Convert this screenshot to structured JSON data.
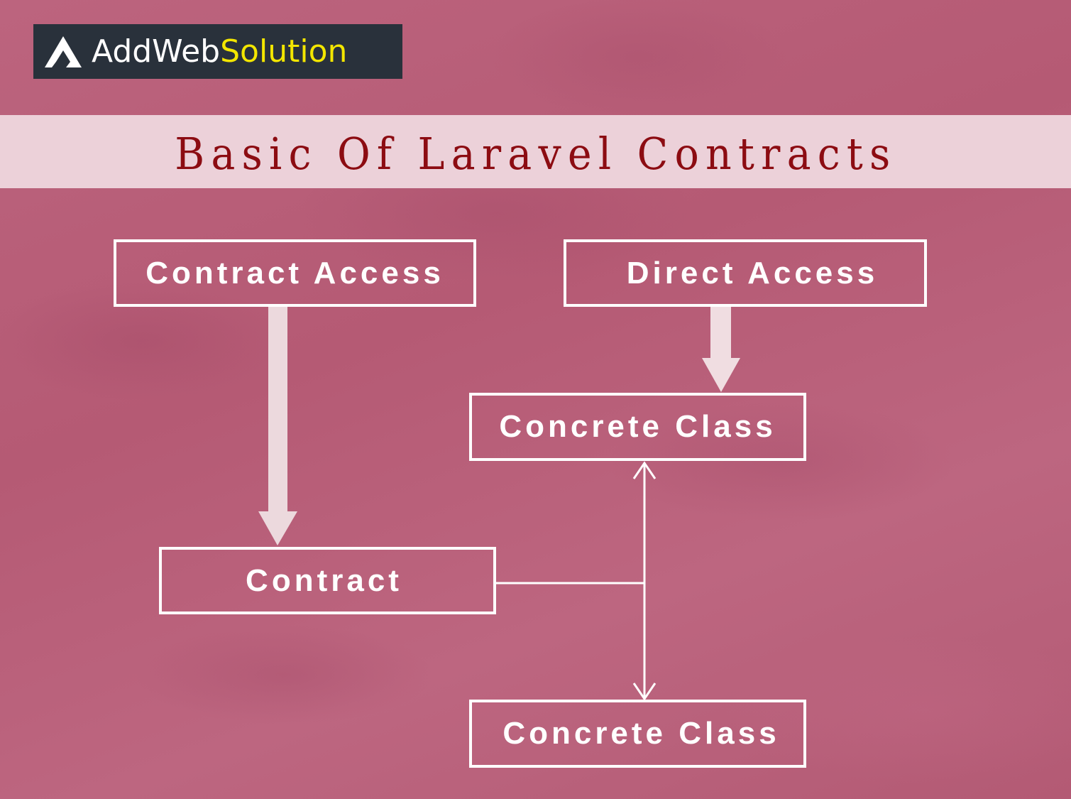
{
  "brand": {
    "name_part1": "AddWeb",
    "name_part2": "Solution",
    "accent_color": "#f3e600",
    "logo_icon": "triangle-a-icon"
  },
  "title": "Basic Of Laravel Contracts",
  "diagram": {
    "nodes": [
      {
        "id": "contract-access",
        "label": "Contract Access"
      },
      {
        "id": "direct-access",
        "label": "Direct Access"
      },
      {
        "id": "concrete-class-1",
        "label": "Concrete Class"
      },
      {
        "id": "contract",
        "label": "Contract"
      },
      {
        "id": "concrete-class-2",
        "label": "Concrete Class"
      }
    ],
    "edges": [
      {
        "from": "contract-access",
        "to": "contract",
        "style": "thick-arrow"
      },
      {
        "from": "direct-access",
        "to": "concrete-class-1",
        "style": "thick-arrow"
      },
      {
        "from": "contract",
        "to": "concrete-class-1",
        "style": "thin-arrow"
      },
      {
        "from": "contract",
        "to": "concrete-class-2",
        "style": "thin-arrow"
      }
    ]
  },
  "colors": {
    "background": "#b9607a",
    "title_band": "#ecd1d9",
    "title_text": "#8c0c12",
    "logo_bg": "#29313b"
  }
}
